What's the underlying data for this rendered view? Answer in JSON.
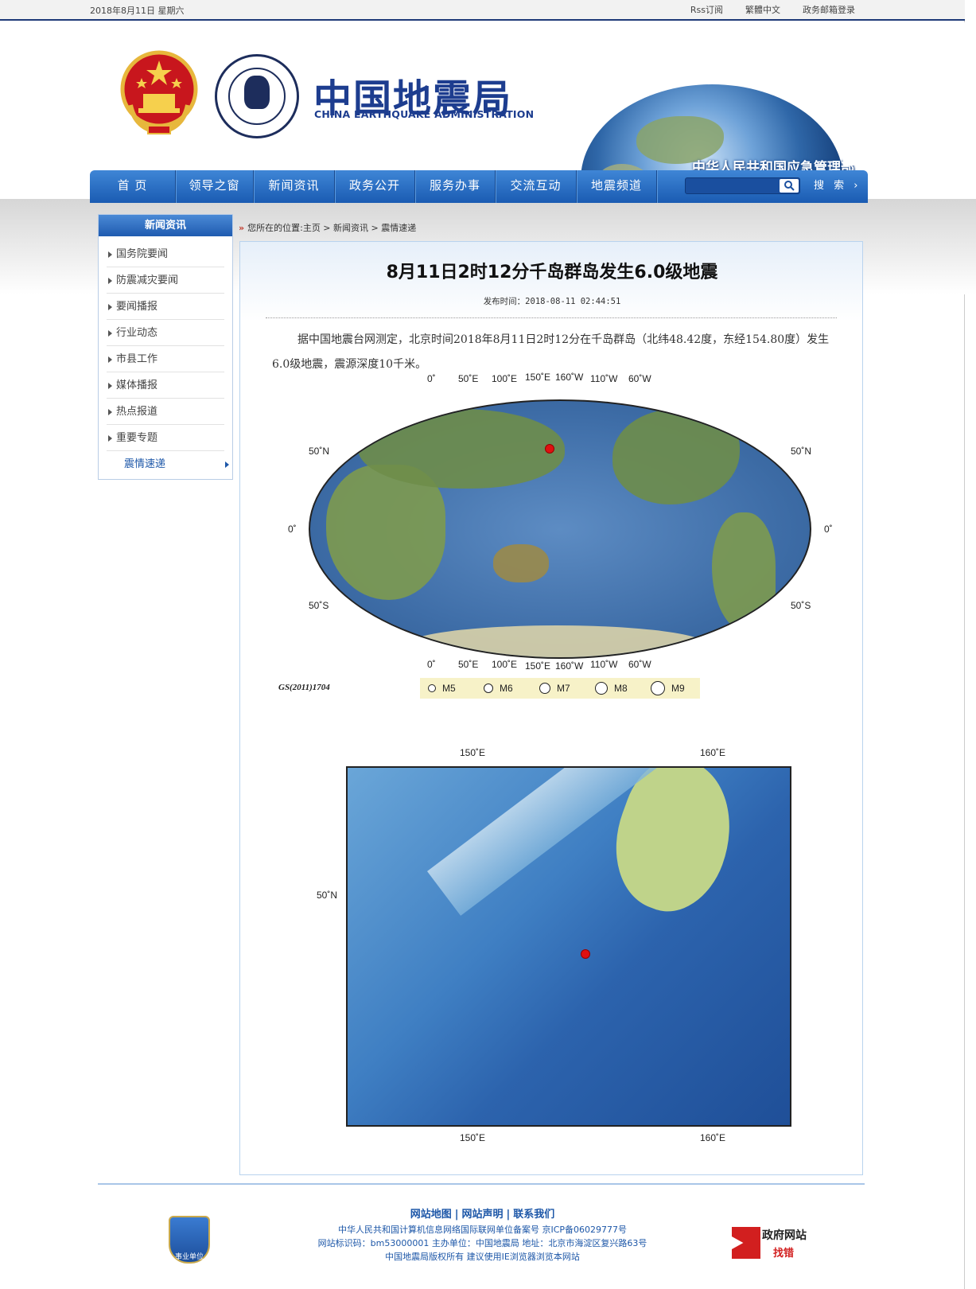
{
  "topbar": {
    "date": "2018年8月11日  星期六",
    "links": [
      "Rss订阅",
      "繁體中文",
      "政务邮箱登录"
    ]
  },
  "header": {
    "title": "中国地震局",
    "subtitle": "CHINA EARTHQUAKE ADMINISTRATION",
    "ministry": "中华人民共和国应急管理部"
  },
  "nav": {
    "items": [
      "首  页",
      "领导之窗",
      "新闻资讯",
      "政务公开",
      "服务办事",
      "交流互动",
      "地震频道"
    ],
    "search_label": "搜 索 ›",
    "search_placeholder": ""
  },
  "sidebar": {
    "title": "新闻资讯",
    "items": [
      "国务院要闻",
      "防震减灾要闻",
      "要闻播报",
      "行业动态",
      "市县工作",
      "媒体播报",
      "热点报道",
      "重要专题",
      "震情速递"
    ],
    "active_index": 8
  },
  "breadcrumb": {
    "arrow": "»",
    "text": "您所在的位置:主页 > 新闻资讯 > 震情速递"
  },
  "article": {
    "title": "8月11日2时12分千岛群岛发生6.0级地震",
    "time": "发布时间：2018-08-11 02:44:51",
    "body": "据中国地震台网测定，北京时间2018年8月11日2时12分在千岛群岛（北纬48.42度，东经154.80度）发生6.0级地震，震源深度10千米。"
  },
  "world_map": {
    "top_lon_labels": [
      "0˚",
      "50˚E",
      "100˚E",
      "150˚E",
      "160˚W",
      "110˚W",
      "60˚W"
    ],
    "bottom_lon_labels": [
      "0˚",
      "50˚E",
      "100˚E",
      "150˚E",
      "160˚W",
      "110˚W",
      "60˚W"
    ],
    "lat_labels_left": [
      "50˚N",
      "0˚",
      "50˚S"
    ],
    "lat_labels_right": [
      "50˚N",
      "0˚",
      "50˚S"
    ],
    "credit": "GS(2011)1704",
    "legend": [
      "M5",
      "M6",
      "M7",
      "M8",
      "M9"
    ],
    "epicenter": {
      "lat": 48.42,
      "lon": 154.8
    }
  },
  "regional_map": {
    "top_labels": [
      "150˚E",
      "160˚E"
    ],
    "bottom_labels": [
      "150˚E",
      "160˚E"
    ],
    "lat_label": "50˚N",
    "epicenter": {
      "lat": 48.42,
      "lon": 154.8
    }
  },
  "footer": {
    "links": [
      "网站地图",
      "网站声明",
      "联系我们"
    ],
    "lines": [
      "中华人民共和国计算机信息网络国际联网单位备案号  京ICP备06029777号",
      "网站标识码：bm53000001  主办单位：中国地震局  地址：北京市海淀区复兴路63号",
      "中国地震局版权所有  建议使用IE浏览器浏览本网站"
    ],
    "badge": "事业单位",
    "gov_site_line1": "政府网站",
    "gov_site_line2": "找错"
  }
}
